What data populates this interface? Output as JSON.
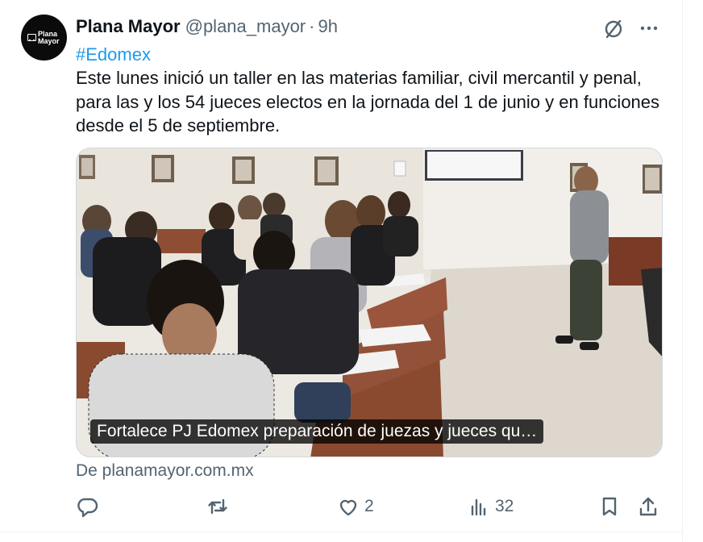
{
  "tweet": {
    "display_name": "Plana Mayor",
    "handle": "@plana_mayor",
    "separator": "·",
    "time": "9h",
    "avatar_logo_text": "Plana Mayor",
    "hashtag": "#Edomex",
    "text": "Este lunes inició un taller en las materias familiar, civil mercantil y penal, para las y los 54 jueces electos en la jornada del 1 de junio y en funciones desde el 5 de septiembre.",
    "media_caption": "Fortalece PJ Edomex preparación de juezas y jueces qu…",
    "source": "De planamayor.com.mx"
  },
  "actions": {
    "reply_count": "",
    "repost_count": "",
    "like_count": "2",
    "views_count": "32"
  },
  "icons": {
    "grok": "slashed-circle-icon",
    "more": "more-dots-icon",
    "reply": "reply-icon",
    "repost": "repost-icon",
    "like": "heart-icon",
    "views": "views-chart-icon",
    "bookmark": "bookmark-icon",
    "share": "share-icon"
  },
  "colors": {
    "text": "#0f1419",
    "secondary": "#536471",
    "link": "#1d9bf0",
    "border": "#cfd9de"
  }
}
